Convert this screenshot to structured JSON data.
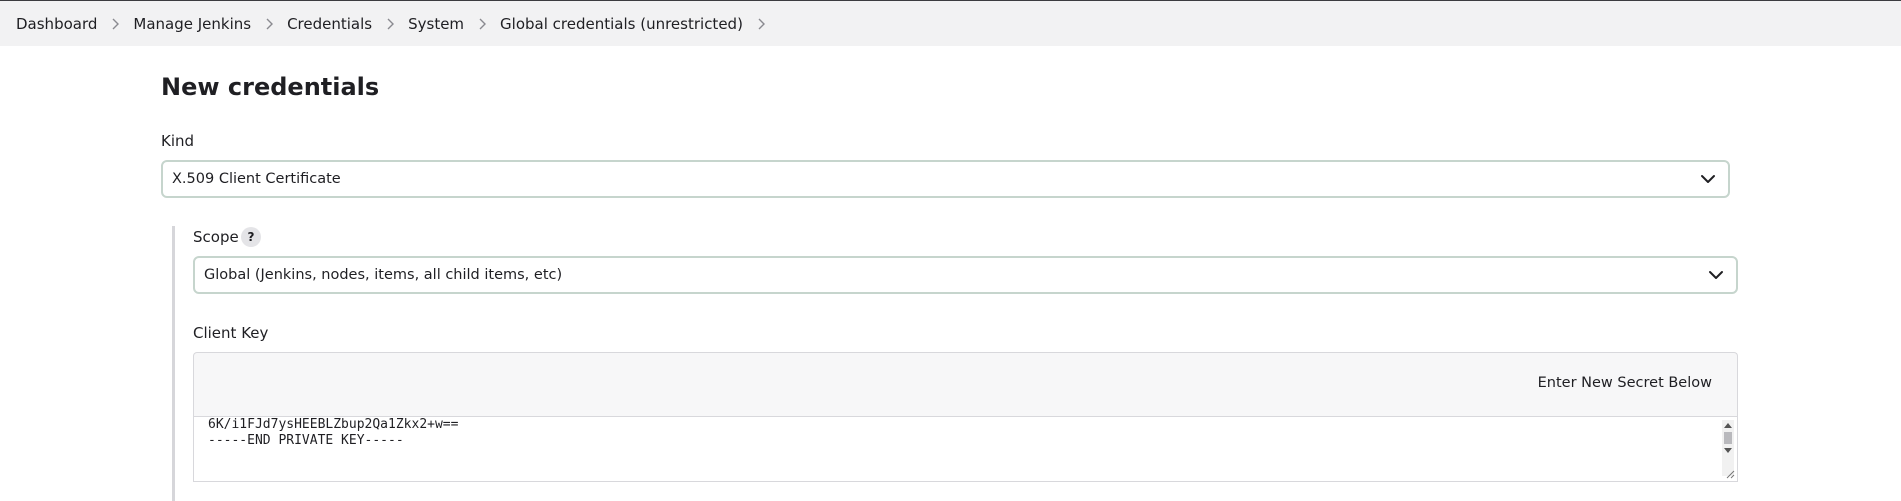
{
  "breadcrumb": {
    "items": [
      {
        "label": "Dashboard"
      },
      {
        "label": "Manage Jenkins"
      },
      {
        "label": "Credentials"
      },
      {
        "label": "System"
      },
      {
        "label": "Global credentials (unrestricted)"
      }
    ]
  },
  "page": {
    "title": "New credentials"
  },
  "kind": {
    "label": "Kind",
    "value": "X.509 Client Certificate"
  },
  "scope": {
    "label": "Scope",
    "help": "?",
    "value": "Global (Jenkins, nodes, items, all child items, etc)"
  },
  "client_key": {
    "label": "Client Key",
    "enter_new_secret_label": "Enter New Secret Below",
    "lines": [
      "6K/i1FJd7ysHEEBLZbup2Qa1Zkx2+w==",
      "-----END PRIVATE KEY-----"
    ]
  },
  "icons": {
    "breadcrumb_separator": "chevron-right-icon",
    "select_arrow": "chevron-down-icon"
  }
}
